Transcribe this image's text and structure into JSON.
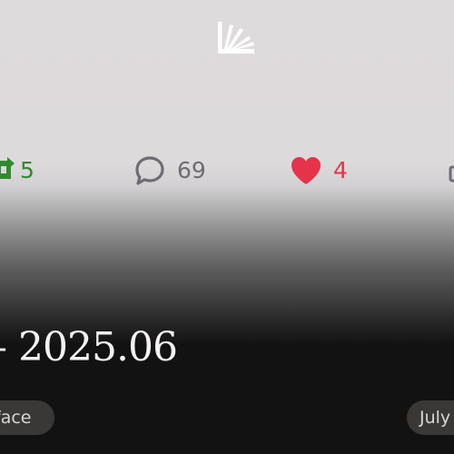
{
  "stats": {
    "reposts": "5",
    "comments": "69",
    "likes": "4"
  },
  "title": {
    "date_range": "– 2025.06"
  },
  "tags": {
    "left_label": "face",
    "right_label": "July"
  },
  "icons": {
    "logo": "sunburst-logo-icon",
    "repost": "repost-icon",
    "comment": "comment-bubble-icon",
    "like": "heart-icon",
    "share": "share-icon"
  },
  "colors": {
    "repost": "#2f8b2d",
    "comment": "#6f6c74",
    "like": "#e5334a",
    "title": "#f3f1f1",
    "tag_bg": "#3a3836"
  }
}
